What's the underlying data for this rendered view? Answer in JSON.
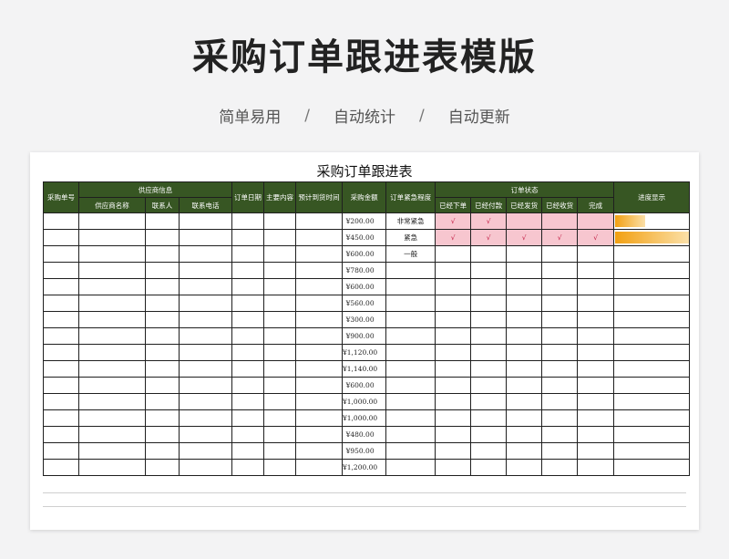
{
  "page": {
    "title": "采购订单跟进表模版",
    "tagline": [
      "简单易用",
      "自动统计",
      "自动更新"
    ],
    "separator": "/"
  },
  "sheet": {
    "title": "采购订单跟进表",
    "header_color": "#375623",
    "check_color": "#f7c6cf",
    "progress_color": "#f2a012",
    "headers": {
      "po_number": "采购单号",
      "supplier_info": "供应商信息",
      "supplier_name": "供应商名称",
      "contact": "联系人",
      "phone": "联系电话",
      "order_date": "订单日期",
      "main_content": "主要内容",
      "eta": "预计到货时间",
      "amount": "采购金额",
      "urgency": "订单紧急程度",
      "order_status": "订单状态",
      "placed": "已经下单",
      "paid": "已经付款",
      "shipped": "已经发货",
      "received": "已经收货",
      "done": "完成",
      "progress": "进度显示"
    },
    "rows": [
      {
        "amount": "¥200.00",
        "urgency": "非常紧急",
        "placed": "√",
        "paid": "√",
        "shipped": "",
        "received": "",
        "done": "",
        "progress": 0.4
      },
      {
        "amount": "¥450.00",
        "urgency": "紧急",
        "placed": "√",
        "paid": "√",
        "shipped": "√",
        "received": "√",
        "done": "√",
        "progress": 1.0
      },
      {
        "amount": "¥600.00",
        "urgency": "一般",
        "placed": "",
        "paid": "",
        "shipped": "",
        "received": "",
        "done": "",
        "progress": 0
      },
      {
        "amount": "¥780.00",
        "urgency": "",
        "placed": "",
        "paid": "",
        "shipped": "",
        "received": "",
        "done": "",
        "progress": 0
      },
      {
        "amount": "¥600.00",
        "urgency": "",
        "placed": "",
        "paid": "",
        "shipped": "",
        "received": "",
        "done": "",
        "progress": 0
      },
      {
        "amount": "¥560.00",
        "urgency": "",
        "placed": "",
        "paid": "",
        "shipped": "",
        "received": "",
        "done": "",
        "progress": 0
      },
      {
        "amount": "¥300.00",
        "urgency": "",
        "placed": "",
        "paid": "",
        "shipped": "",
        "received": "",
        "done": "",
        "progress": 0
      },
      {
        "amount": "¥900.00",
        "urgency": "",
        "placed": "",
        "paid": "",
        "shipped": "",
        "received": "",
        "done": "",
        "progress": 0
      },
      {
        "amount": "¥1,120.00",
        "urgency": "",
        "placed": "",
        "paid": "",
        "shipped": "",
        "received": "",
        "done": "",
        "progress": 0
      },
      {
        "amount": "¥1,140.00",
        "urgency": "",
        "placed": "",
        "paid": "",
        "shipped": "",
        "received": "",
        "done": "",
        "progress": 0
      },
      {
        "amount": "¥600.00",
        "urgency": "",
        "placed": "",
        "paid": "",
        "shipped": "",
        "received": "",
        "done": "",
        "progress": 0
      },
      {
        "amount": "¥1,000.00",
        "urgency": "",
        "placed": "",
        "paid": "",
        "shipped": "",
        "received": "",
        "done": "",
        "progress": 0
      },
      {
        "amount": "¥1,000.00",
        "urgency": "",
        "placed": "",
        "paid": "",
        "shipped": "",
        "received": "",
        "done": "",
        "progress": 0
      },
      {
        "amount": "¥480.00",
        "urgency": "",
        "placed": "",
        "paid": "",
        "shipped": "",
        "received": "",
        "done": "",
        "progress": 0
      },
      {
        "amount": "¥950.00",
        "urgency": "",
        "placed": "",
        "paid": "",
        "shipped": "",
        "received": "",
        "done": "",
        "progress": 0
      },
      {
        "amount": "¥1,200.00",
        "urgency": "",
        "placed": "",
        "paid": "",
        "shipped": "",
        "received": "",
        "done": "",
        "progress": 0
      }
    ]
  }
}
